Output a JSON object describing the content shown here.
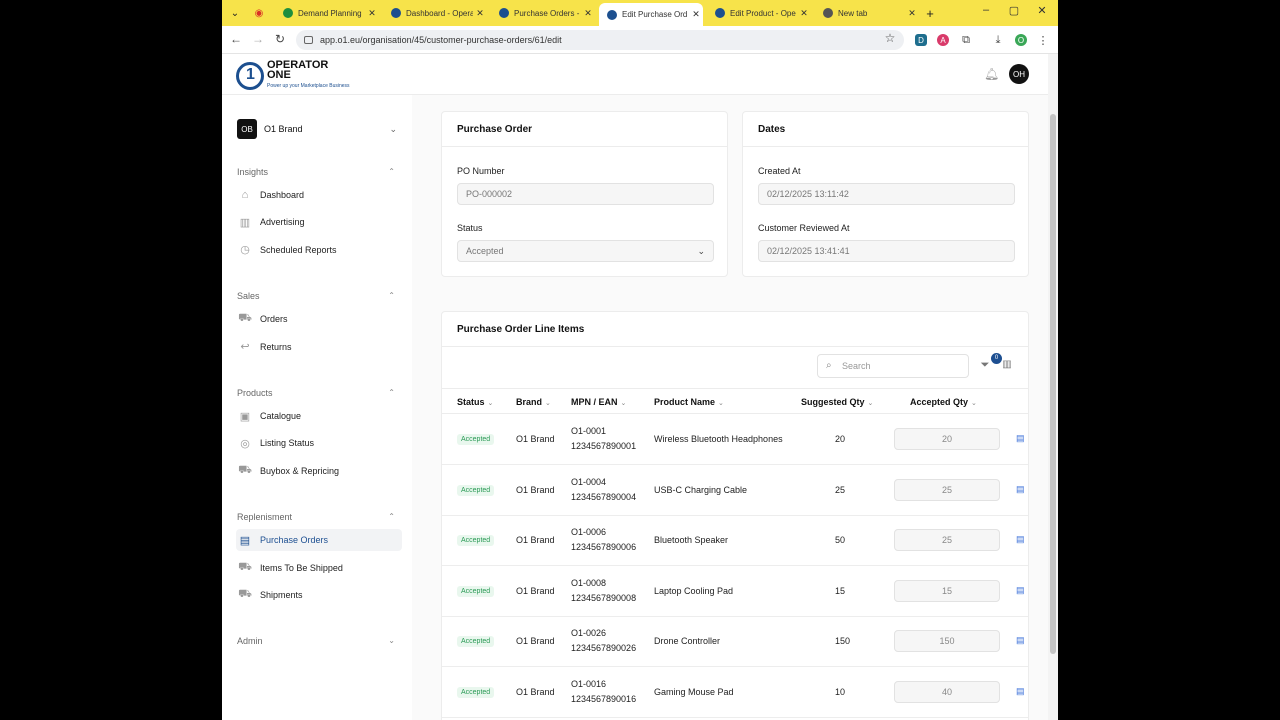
{
  "browser": {
    "tabs": [
      {
        "title": "Demand Planning",
        "color": "#1e8e3e",
        "active": false
      },
      {
        "title": "Dashboard - Opera",
        "color": "#1c4f8f",
        "active": false
      },
      {
        "title": "Purchase Orders -",
        "color": "#1c4f8f",
        "active": false
      },
      {
        "title": "Edit Purchase Ord",
        "color": "#1c4f8f",
        "active": true
      },
      {
        "title": "Edit Product - Ope",
        "color": "#1c4f8f",
        "active": false
      },
      {
        "title": "New tab",
        "color": "#555555",
        "active": false
      }
    ],
    "url": "app.o1.eu/organisation/45/customer-purchase-orders/61/edit"
  },
  "header": {
    "logo_line1": "OPERATOR",
    "logo_line2": "ONE",
    "logo_tagline": "Power up your Marketplace Business",
    "avatar": "OH"
  },
  "sidebar": {
    "brand_initials": "OB",
    "brand_name": "O1 Brand",
    "sections": [
      {
        "label": "Insights",
        "items": [
          {
            "label": "Dashboard",
            "icon": "home-icon"
          },
          {
            "label": "Advertising",
            "icon": "chart-icon"
          },
          {
            "label": "Scheduled Reports",
            "icon": "clock-icon"
          }
        ]
      },
      {
        "label": "Sales",
        "items": [
          {
            "label": "Orders",
            "icon": "cart-icon"
          },
          {
            "label": "Returns",
            "icon": "return-icon"
          }
        ]
      },
      {
        "label": "Products",
        "items": [
          {
            "label": "Catalogue",
            "icon": "gift-icon"
          },
          {
            "label": "Listing Status",
            "icon": "check-circle-icon"
          },
          {
            "label": "Buybox & Repricing",
            "icon": "cart-icon"
          }
        ]
      },
      {
        "label": "Replenisment",
        "items": [
          {
            "label": "Purchase Orders",
            "icon": "document-icon",
            "active": true
          },
          {
            "label": "Items To Be Shipped",
            "icon": "truck-icon"
          },
          {
            "label": "Shipments",
            "icon": "truck-icon"
          }
        ]
      },
      {
        "label": "Admin",
        "items": []
      }
    ]
  },
  "purchase_order": {
    "title": "Purchase Order",
    "po_label": "PO Number",
    "po_value": "PO-000002",
    "status_label": "Status",
    "status_value": "Accepted"
  },
  "dates": {
    "title": "Dates",
    "created_label": "Created At",
    "created_value": "02/12/2025 13:11:42",
    "reviewed_label": "Customer Reviewed At",
    "reviewed_value": "02/12/2025 13:41:41"
  },
  "line_items": {
    "title": "Purchase Order Line Items",
    "search_placeholder": "Search",
    "filter_count": "0",
    "columns": [
      "Status",
      "Brand",
      "MPN / EAN",
      "Product Name",
      "Suggested Qty",
      "Accepted Qty"
    ],
    "rows": [
      {
        "status": "Accepted",
        "brand": "O1 Brand",
        "mpn": "O1-0001",
        "ean": "1234567890001",
        "product": "Wireless Bluetooth Headphones",
        "suggested": "20",
        "accepted": "20"
      },
      {
        "status": "Accepted",
        "brand": "O1 Brand",
        "mpn": "O1-0004",
        "ean": "1234567890004",
        "product": "USB-C Charging Cable",
        "suggested": "25",
        "accepted": "25"
      },
      {
        "status": "Accepted",
        "brand": "O1 Brand",
        "mpn": "O1-0006",
        "ean": "1234567890006",
        "product": "Bluetooth Speaker",
        "suggested": "50",
        "accepted": "25"
      },
      {
        "status": "Accepted",
        "brand": "O1 Brand",
        "mpn": "O1-0008",
        "ean": "1234567890008",
        "product": "Laptop Cooling Pad",
        "suggested": "15",
        "accepted": "15"
      },
      {
        "status": "Accepted",
        "brand": "O1 Brand",
        "mpn": "O1-0026",
        "ean": "1234567890026",
        "product": "Drone Controller",
        "suggested": "150",
        "accepted": "150"
      },
      {
        "status": "Accepted",
        "brand": "O1 Brand",
        "mpn": "O1-0016",
        "ean": "1234567890016",
        "product": "Gaming Mouse Pad",
        "suggested": "10",
        "accepted": "40"
      }
    ]
  }
}
